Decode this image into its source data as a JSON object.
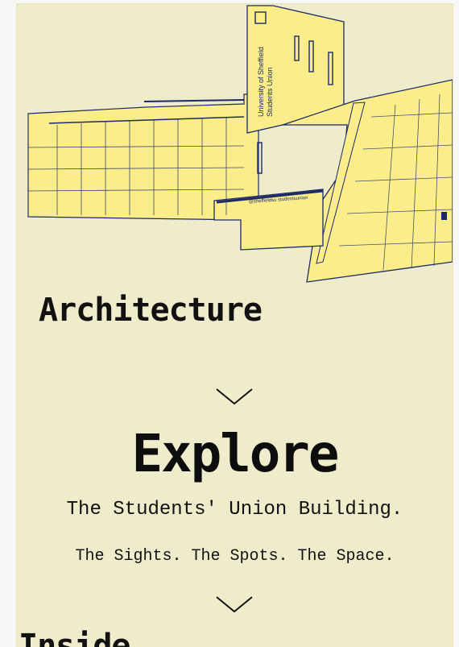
{
  "hero": {
    "image_alt": "Students' Union building illustration",
    "sign_line_1": "University of Sheffield",
    "sign_line_2": "Students Union",
    "canopy_sign": "@sheffieldsu  studentsunion",
    "palette": {
      "fill": "#fbee8a",
      "ink": "#1d2a66"
    }
  },
  "sections": {
    "architecture_title": "Architecture",
    "explore_title": "Explore",
    "explore_subtitle": "The Students' Union Building.",
    "explore_tagline": "The Sights. The Spots. The Space.",
    "next_title": "Inside"
  },
  "icons": {
    "scroll_down_1": "chevron-down-icon",
    "scroll_down_2": "chevron-down-icon"
  },
  "colors": {
    "page_background": "#efeccb",
    "text": "#111111"
  }
}
